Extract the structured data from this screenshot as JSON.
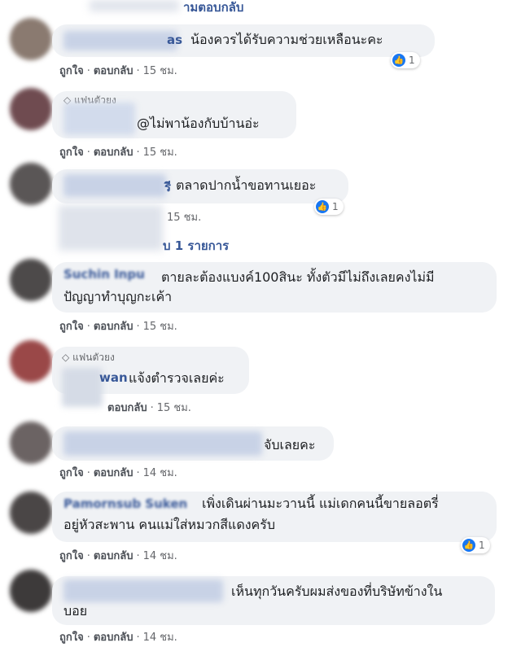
{
  "top_partial": "ามตอบกลับ",
  "actions": {
    "like": "ถูกใจ",
    "reply": "ตอบกลับ",
    "dot": "·"
  },
  "comments": [
    {
      "name_tail": "as",
      "text": "น้องควรได้รับความช่วยเหลือนะคะ",
      "time": "15 ชม.",
      "reactions": "1"
    },
    {
      "fan_badge": "แฟนตัวยง",
      "text": "@ไม่พาน้องกับบ้านอ่ะ",
      "time": "15 ชม."
    },
    {
      "name_tail": "รี",
      "text": "ตลาดปากน้ำขอทานเยอะ",
      "time": "15 ชม.",
      "reactions": "1",
      "replies": "บ 1 รายการ"
    },
    {
      "name_tail": "Suchin Inpu",
      "text_line1": "ตายละต้องแบงค์100สินะ ทั้งตัวมีไม่ถึงเลยคงไม่มี",
      "text_line2": "ปัญญาทำบุญกะเค้า",
      "time": "15 ชม."
    },
    {
      "fan_badge": "แฟนตัวยง",
      "name_tail": "wan",
      "text": "แจ้งตำรวจเลยค่ะ",
      "time": "15 ชม."
    },
    {
      "text": "จับเลยคะ",
      "time": "14 ชม."
    },
    {
      "name_tail": "Pamornsub Suken",
      "text_line1": "เพิ่งเดินผ่านมะวานนี้ แม่เดกคนนี้ขายลอตรี่",
      "text_line2": "อยู่หัวสะพาน คนแม่ใส่หมวกสีแดงครับ",
      "time": "14 ชม.",
      "reactions": "1"
    },
    {
      "text_line1": "เห็นทุกวันครับผมส่งของที่บริษัทข้างใน",
      "text_line2": "บอย",
      "time": "14 ชม."
    }
  ],
  "colors": {
    "bubble": "#f0f2f5",
    "link": "#385898",
    "like": "#1877f2"
  }
}
